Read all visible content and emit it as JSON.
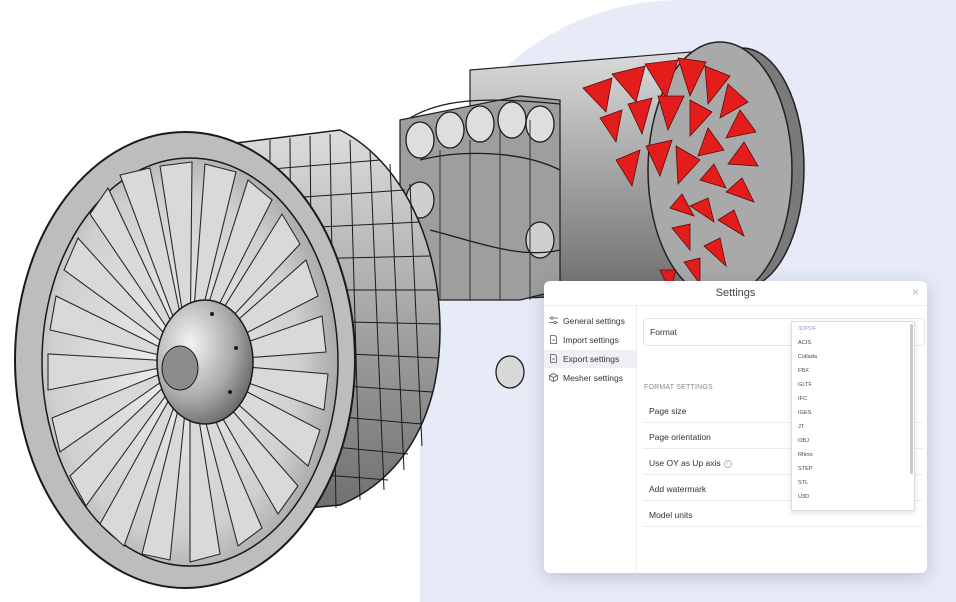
{
  "dialog": {
    "title": "Settings",
    "close_glyph": "×",
    "sidebar": [
      {
        "label": "General settings",
        "icon": "sliders-icon"
      },
      {
        "label": "Import settings",
        "icon": "import-file-icon"
      },
      {
        "label": "Export settings",
        "icon": "export-file-icon",
        "active": true
      },
      {
        "label": "Mesher settings",
        "icon": "cube-icon"
      }
    ],
    "format_label": "Format",
    "section_header": "FORMAT SETTINGS",
    "rows": [
      "Page size",
      "Page orientation",
      "Use OY as Up axis",
      "Add watermark",
      "Model units"
    ],
    "info_glyph": "i",
    "format_options": [
      "3DPDF",
      "ACIS",
      "Collada",
      "FBX",
      "GLTF",
      "IFC",
      "IGES",
      "JT",
      "OBJ",
      "Rhino",
      "STEP",
      "STL",
      "U3D"
    ],
    "selected_format": "3DPDF"
  },
  "colors": {
    "background_blob": "#e7ebf7",
    "highlight_red": "#e31c1c",
    "engine_gray": "#9c9c9c"
  }
}
